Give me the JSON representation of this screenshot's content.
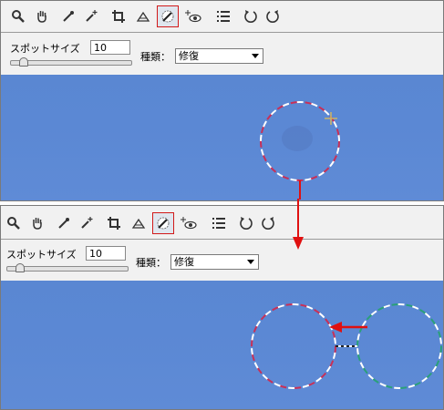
{
  "panels": [
    {
      "options": {
        "spot_size_label": "スポットサイズ",
        "spot_size_value": "10",
        "type_label": "種類：",
        "type_value": "修復",
        "slider_fraction": 0.1
      },
      "selected_tool": "spot-removal"
    },
    {
      "options": {
        "spot_size_label": "スポットサイズ",
        "spot_size_value": "10",
        "type_label": "種類：",
        "type_value": "修復",
        "slider_fraction": 0.1
      },
      "selected_tool": "spot-removal"
    }
  ],
  "tools": [
    "zoom-icon",
    "hand-icon",
    "eyedropper-icon",
    "color-sampler-icon",
    "crop-icon",
    "straighten-icon",
    "spot-removal-icon",
    "red-eye-icon",
    "list-icon",
    "rotate-left-icon",
    "rotate-right-icon"
  ],
  "colors": {
    "highlight": "#d21a1a",
    "sky": "#5a87d2",
    "circle_red": "#d23a5a",
    "circle_green": "#2aa07a",
    "arrow": "#e01010"
  }
}
